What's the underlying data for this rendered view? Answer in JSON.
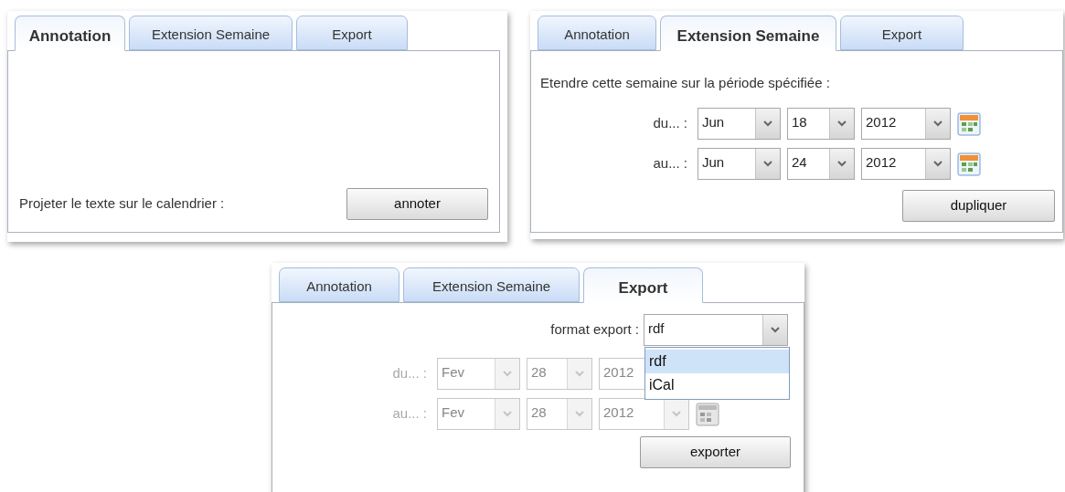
{
  "panels": [
    {
      "kind": "annotation",
      "tabs": [
        {
          "label": "Annotation",
          "selected": true
        },
        {
          "label": "Extension Semaine",
          "selected": false
        },
        {
          "label": "Export",
          "selected": false
        }
      ],
      "prompt": "Projeter le texte sur le calendrier :",
      "button": "annoter"
    },
    {
      "kind": "extension",
      "tabs": [
        {
          "label": "Annotation",
          "selected": false
        },
        {
          "label": "Extension Semaine",
          "selected": true
        },
        {
          "label": "Export",
          "selected": false
        }
      ],
      "intro": "Etendre cette semaine sur la période spécifiée :",
      "disabled": false,
      "rows": [
        {
          "label": "du... :",
          "month": "Jun",
          "day": "18",
          "year": "2012"
        },
        {
          "label": "au... :",
          "month": "Jun",
          "day": "24",
          "year": "2012"
        }
      ],
      "button": "dupliquer"
    },
    {
      "kind": "export",
      "tabs": [
        {
          "label": "Annotation",
          "selected": false
        },
        {
          "label": "Extension Semaine",
          "selected": false
        },
        {
          "label": "Export",
          "selected": true
        }
      ],
      "format_label": "format export :",
      "format_value": "rdf",
      "expanded": true,
      "options": [
        {
          "label": "rdf",
          "selected": true
        },
        {
          "label": "iCal",
          "selected": false
        }
      ],
      "disabled": true,
      "rows": [
        {
          "label": "du... :",
          "month": "Fev",
          "day": "28",
          "year": "2012"
        },
        {
          "label": "au... :",
          "month": "Fev",
          "day": "28",
          "year": "2012"
        }
      ],
      "button": "exporter"
    }
  ]
}
